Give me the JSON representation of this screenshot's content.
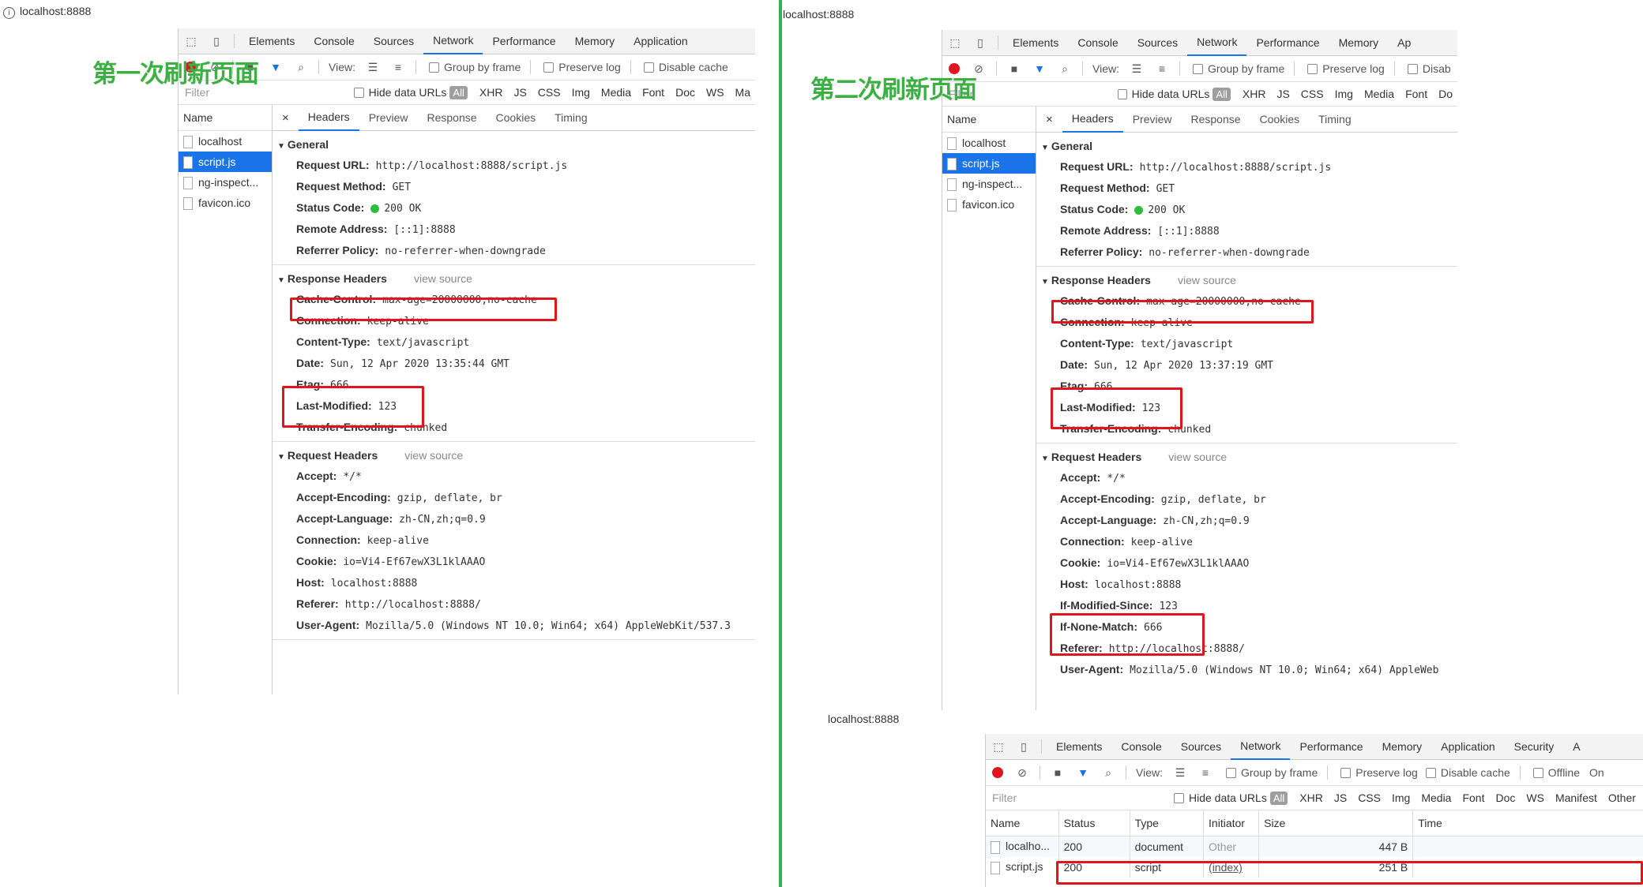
{
  "captions": {
    "first": "第一次刷新页面",
    "second": "第二次刷新页面"
  },
  "colors": {
    "highlight": "#e0161e",
    "caption": "#3cb043",
    "divider": "#2fb34a",
    "tab_accent": "#1a73e8",
    "status_ok": "#2bbd3c"
  },
  "left": {
    "url": "localhost:8888",
    "tabs": [
      "Elements",
      "Console",
      "Sources",
      "Network",
      "Performance",
      "Memory",
      "Application"
    ],
    "active_tab": "Network",
    "toolbar": {
      "view_label": "View:",
      "group_by_frame": "Group by frame",
      "preserve_log": "Preserve log",
      "disable_cache": "Disable cache"
    },
    "filter": {
      "placeholder": "Filter",
      "hide_data_urls": "Hide data URLs",
      "all": "All",
      "types": [
        "XHR",
        "JS",
        "CSS",
        "Img",
        "Media",
        "Font",
        "Doc",
        "WS",
        "Ma"
      ]
    },
    "names": {
      "header": "Name",
      "items": [
        "localhost",
        "script.js",
        "ng-inspect...",
        "favicon.ico"
      ]
    },
    "detail_tabs": [
      "Headers",
      "Preview",
      "Response",
      "Cookies",
      "Timing"
    ],
    "general": {
      "title": "General",
      "rows": [
        {
          "k": "Request URL:",
          "v": "http://localhost:8888/script.js"
        },
        {
          "k": "Request Method:",
          "v": "GET"
        },
        {
          "k": "Status Code:",
          "v": "200 OK"
        },
        {
          "k": "Remote Address:",
          "v": "[::1]:8888"
        },
        {
          "k": "Referrer Policy:",
          "v": "no-referrer-when-downgrade"
        }
      ]
    },
    "response": {
      "title": "Response Headers",
      "view_source": "view source",
      "rows": [
        {
          "k": "Cache-Control:",
          "v": "max-age=20000000,no-cache"
        },
        {
          "k": "Connection:",
          "v": "keep-alive"
        },
        {
          "k": "Content-Type:",
          "v": "text/javascript"
        },
        {
          "k": "Date:",
          "v": "Sun, 12 Apr 2020 13:35:44 GMT"
        },
        {
          "k": "Etag:",
          "v": "666"
        },
        {
          "k": "Last-Modified:",
          "v": "123"
        },
        {
          "k": "Transfer-Encoding:",
          "v": "chunked"
        }
      ]
    },
    "request": {
      "title": "Request Headers",
      "view_source": "view source",
      "rows": [
        {
          "k": "Accept:",
          "v": "*/*"
        },
        {
          "k": "Accept-Encoding:",
          "v": "gzip, deflate, br"
        },
        {
          "k": "Accept-Language:",
          "v": "zh-CN,zh;q=0.9"
        },
        {
          "k": "Connection:",
          "v": "keep-alive"
        },
        {
          "k": "Cookie:",
          "v": "io=Vi4-Ef67ewX3L1klAAAO"
        },
        {
          "k": "Host:",
          "v": "localhost:8888"
        },
        {
          "k": "Referer:",
          "v": "http://localhost:8888/"
        },
        {
          "k": "User-Agent:",
          "v": "Mozilla/5.0 (Windows NT 10.0; Win64; x64) AppleWebKit/537.3"
        }
      ]
    }
  },
  "right": {
    "url": "localhost:8888",
    "tabs": [
      "Elements",
      "Console",
      "Sources",
      "Network",
      "Performance",
      "Memory",
      "Ap"
    ],
    "active_tab": "Network",
    "toolbar": {
      "view_label": "View:",
      "group_by_frame": "Group by frame",
      "preserve_log": "Preserve log",
      "disable_cache": "Disab"
    },
    "filter": {
      "placeholder": "Filter",
      "hide_data_urls": "Hide data URLs",
      "all": "All",
      "types": [
        "XHR",
        "JS",
        "CSS",
        "Img",
        "Media",
        "Font",
        "Do"
      ]
    },
    "names": {
      "header": "Name",
      "items": [
        "localhost",
        "script.js",
        "ng-inspect...",
        "favicon.ico"
      ]
    },
    "detail_tabs": [
      "Headers",
      "Preview",
      "Response",
      "Cookies",
      "Timing"
    ],
    "general": {
      "title": "General",
      "rows": [
        {
          "k": "Request URL:",
          "v": "http://localhost:8888/script.js"
        },
        {
          "k": "Request Method:",
          "v": "GET"
        },
        {
          "k": "Status Code:",
          "v": "200 OK"
        },
        {
          "k": "Remote Address:",
          "v": "[::1]:8888"
        },
        {
          "k": "Referrer Policy:",
          "v": "no-referrer-when-downgrade"
        }
      ]
    },
    "response": {
      "title": "Response Headers",
      "view_source": "view source",
      "rows": [
        {
          "k": "Cache-Control:",
          "v": "max-age=20000000,no-cache"
        },
        {
          "k": "Connection:",
          "v": "keep-alive"
        },
        {
          "k": "Content-Type:",
          "v": "text/javascript"
        },
        {
          "k": "Date:",
          "v": "Sun, 12 Apr 2020 13:37:19 GMT"
        },
        {
          "k": "Etag:",
          "v": "666"
        },
        {
          "k": "Last-Modified:",
          "v": "123"
        },
        {
          "k": "Transfer-Encoding:",
          "v": "chunked"
        }
      ]
    },
    "request": {
      "title": "Request Headers",
      "view_source": "view source",
      "rows": [
        {
          "k": "Accept:",
          "v": "*/*"
        },
        {
          "k": "Accept-Encoding:",
          "v": "gzip, deflate, br"
        },
        {
          "k": "Accept-Language:",
          "v": "zh-CN,zh;q=0.9"
        },
        {
          "k": "Connection:",
          "v": "keep-alive"
        },
        {
          "k": "Cookie:",
          "v": "io=Vi4-Ef67ewX3L1klAAAO"
        },
        {
          "k": "Host:",
          "v": "localhost:8888"
        },
        {
          "k": "If-Modified-Since:",
          "v": "123"
        },
        {
          "k": "If-None-Match:",
          "v": "666"
        },
        {
          "k": "Referer:",
          "v": "http://localhost:8888/"
        },
        {
          "k": "User-Agent:",
          "v": "Mozilla/5.0 (Windows NT 10.0; Win64; x64) AppleWeb"
        }
      ]
    }
  },
  "bottom": {
    "url": "localhost:8888",
    "tabs": [
      "Elements",
      "Console",
      "Sources",
      "Network",
      "Performance",
      "Memory",
      "Application",
      "Security",
      "A"
    ],
    "active_tab": "Network",
    "toolbar": {
      "view_label": "View:",
      "group_by_frame": "Group by frame",
      "preserve_log": "Preserve log",
      "disable_cache": "Disable cache",
      "offline": "Offline",
      "online": "On"
    },
    "filter": {
      "placeholder": "Filter",
      "hide_data_urls": "Hide data URLs",
      "all": "All",
      "types": [
        "XHR",
        "JS",
        "CSS",
        "Img",
        "Media",
        "Font",
        "Doc",
        "WS",
        "Manifest",
        "Other"
      ]
    },
    "columns": [
      "Name",
      "Status",
      "Type",
      "Initiator",
      "Size",
      "Time"
    ],
    "rows": [
      {
        "name": "localho...",
        "status": "200",
        "type": "document",
        "initiator": "Other",
        "size": "447 B",
        "time": ""
      },
      {
        "name": "script.js",
        "status": "200",
        "type": "script",
        "initiator": "(index)",
        "size": "251 B",
        "time": ""
      }
    ]
  }
}
